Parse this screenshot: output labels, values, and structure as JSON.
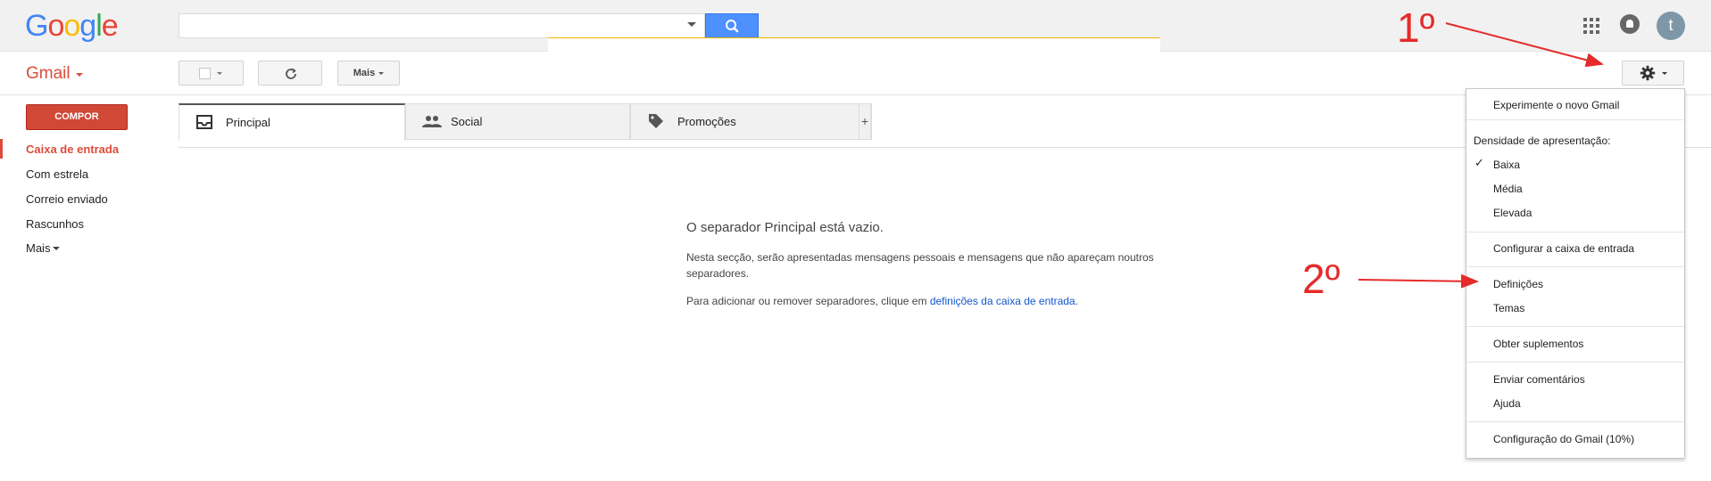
{
  "header": {
    "logo_text": [
      "G",
      "o",
      "o",
      "g",
      "l",
      "e"
    ],
    "search": {
      "value": "",
      "placeholder": ""
    },
    "icons": [
      "apps-grid-icon",
      "notifications-icon"
    ],
    "avatar_letter": "t"
  },
  "toolbar": {
    "gmail_label": "Gmail",
    "more_label": "Mais"
  },
  "sidebar": {
    "compose_label": "COMPOR",
    "items": [
      {
        "label": "Caixa de entrada",
        "active": true
      },
      {
        "label": "Com estrela"
      },
      {
        "label": "Correio enviado"
      },
      {
        "label": "Rascunhos"
      },
      {
        "label": "Mais"
      }
    ]
  },
  "tabs": [
    {
      "label": "Principal",
      "icon": "inbox-icon",
      "active": true
    },
    {
      "label": "Social",
      "icon": "people-icon"
    },
    {
      "label": "Promoções",
      "icon": "tag-icon"
    }
  ],
  "tab_add_label": "+",
  "empty_state": {
    "title": "O separador Principal está vazio.",
    "description": "Nesta secção, serão apresentadas mensagens pessoais e mensagens que não apareçam noutros separadores.",
    "hint_prefix": "Para adicionar ou remover separadores, clique em ",
    "hint_link": "definições da caixa de entrada",
    "hint_suffix": "."
  },
  "settings_menu": {
    "try_new": "Experimente o novo Gmail",
    "density_header": "Densidade de apresentação:",
    "density_options": [
      "Baixa",
      "Média",
      "Elevada"
    ],
    "density_selected": "Baixa",
    "configure_inbox": "Configurar a caixa de entrada",
    "settings": "Definições",
    "themes": "Temas",
    "get_addons": "Obter suplementos",
    "send_feedback": "Enviar comentários",
    "help": "Ajuda",
    "gmail_config": "Configuração do Gmail (10%)"
  },
  "annotations": {
    "step_1": "1º",
    "step_2": "2º",
    "color": "#e52a2a"
  },
  "colors": {
    "gmail_red": "#dd4b39",
    "compose_red": "#d14836",
    "search_blue": "#4d90fe",
    "link_blue": "#1155cc"
  }
}
